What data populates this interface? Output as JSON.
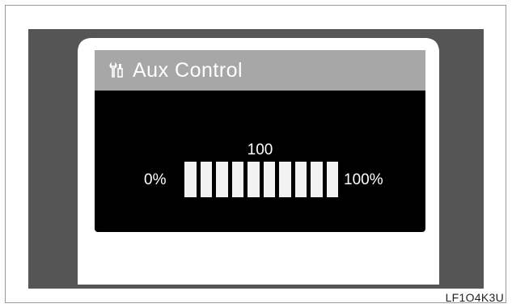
{
  "screen": {
    "title": "Aux Control",
    "title_icon": "wrench-screwdriver-icon",
    "value": "100",
    "min_label": "0%",
    "max_label": "100%",
    "level_fraction": 1.0,
    "segments": 10
  },
  "figure_code": "LF1O4K3U",
  "colors": {
    "panel": "#555555",
    "title_bar": "#a7a7a7",
    "screen": "#000000",
    "segment_on": "#f2f2f2"
  }
}
